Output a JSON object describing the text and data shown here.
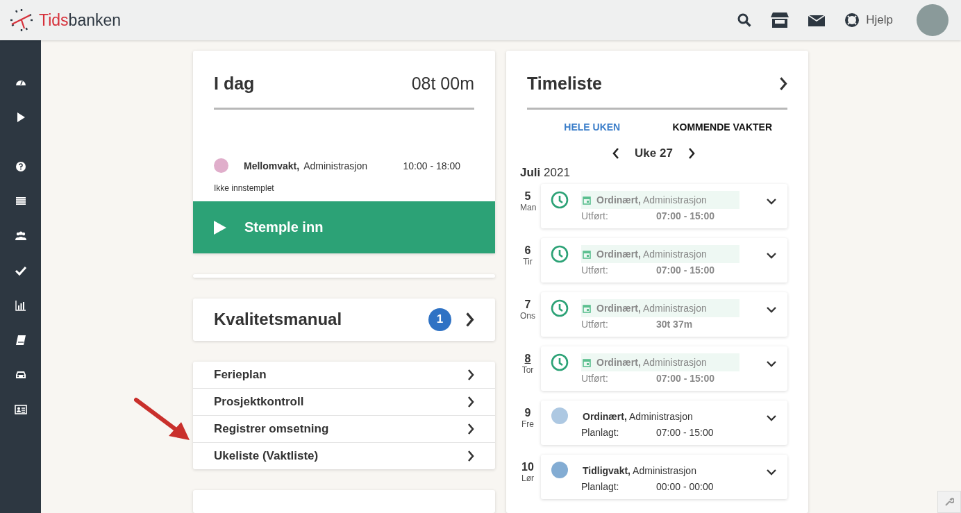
{
  "header": {
    "brand_highlight": "Tids",
    "brand_rest": "banken",
    "help_label": "Hjelp"
  },
  "today": {
    "title": "I dag",
    "total": "08t 00m",
    "shift": {
      "color": "#e0aecb",
      "name": "Mellomvakt,",
      "department": "Administrasjon",
      "time": "10:00 - 18:00"
    },
    "status": "Ikke innstemplet",
    "action": "Stemple inn"
  },
  "quality": {
    "title": "Kvalitetsmanual",
    "badge": "1"
  },
  "links": [
    "Ferieplan",
    "Prosjektkontroll",
    "Registrer omsetning",
    "Ukeliste (Vaktliste)"
  ],
  "timesheet": {
    "title": "Timeliste",
    "tabs": [
      {
        "label": "HELE UKEN",
        "selected": true
      },
      {
        "label": "KOMMENDE VAKTER",
        "selected": false
      }
    ],
    "week": "Uke 27",
    "month": "Juli",
    "year": "2021",
    "days": [
      {
        "day": "5",
        "weekday": "Man",
        "today": false,
        "kind": "done",
        "name": "Ordinært,",
        "department": "Administrasjon",
        "status_label": "Utført:",
        "time": "07:00 - 15:00"
      },
      {
        "day": "6",
        "weekday": "Tir",
        "today": false,
        "kind": "done",
        "name": "Ordinært,",
        "department": "Administrasjon",
        "status_label": "Utført:",
        "time": "07:00 - 15:00"
      },
      {
        "day": "7",
        "weekday": "Ons",
        "today": false,
        "kind": "done",
        "name": "Ordinært,",
        "department": "Administrasjon",
        "status_label": "Utført:",
        "time": "30t 37m"
      },
      {
        "day": "8",
        "weekday": "Tor",
        "today": true,
        "kind": "done",
        "name": "Ordinært,",
        "department": "Administrasjon",
        "status_label": "Utført:",
        "time": "07:00 - 15:00"
      },
      {
        "day": "9",
        "weekday": "Fre",
        "today": false,
        "kind": "planned",
        "color": "#adc8e2",
        "name": "Ordinært,",
        "department": "Administrasjon",
        "status_label": "Planlagt:",
        "time": "07:00 - 15:00"
      },
      {
        "day": "10",
        "weekday": "Lør",
        "today": false,
        "kind": "planned",
        "color": "#83acd3",
        "name": "Tidligvakt,",
        "department": "Administrasjon",
        "status_label": "Planlagt:",
        "time": "00:00 - 00:00"
      }
    ]
  }
}
